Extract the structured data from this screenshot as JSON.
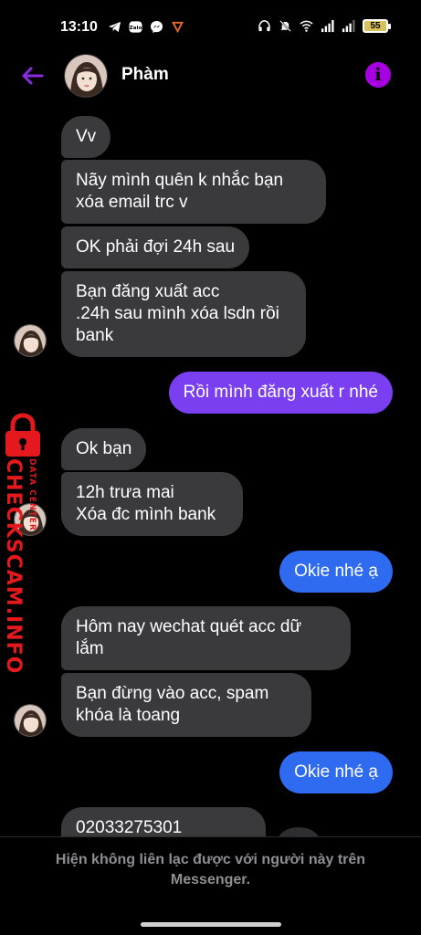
{
  "status_bar": {
    "time": "13:10",
    "left_icons": [
      "telegram-icon",
      "zalo-icon",
      "messenger-icon",
      "vpn-icon"
    ],
    "right_icons": [
      "headphones-icon",
      "mute-icon",
      "wifi-icon",
      "signal-icon",
      "signal-icon"
    ],
    "battery": "55"
  },
  "header": {
    "contact_name": "Phàm",
    "back_icon": "arrow-left-icon",
    "info_icon": "info-icon",
    "info_symbol": "i",
    "accent_color": "#8a2be2"
  },
  "messages": [
    {
      "side": "in",
      "text": "Vv"
    },
    {
      "side": "in",
      "text": "Nãy  mình  quên  k nhắc  bạn\nxóa email  trc v"
    },
    {
      "side": "in",
      "text": "OK  phải  đợi 24h sau"
    },
    {
      "side": "in",
      "text": "Bạn  đăng xuất acc\n.24h sau mình xóa lsdn rồi\nbank"
    },
    {
      "side": "out",
      "text": "Rồi mình đăng xuất r nhé",
      "color": "#7b3ff2"
    },
    {
      "side": "in",
      "text": "Ok  bạn"
    },
    {
      "side": "in",
      "text": "12h trưa mai\nXóa đc  mình bank"
    },
    {
      "side": "out",
      "text": "Okie nhé ạ",
      "color": "#2f6bf0"
    },
    {
      "side": "in",
      "text": "Hôm nay wechat  quét acc dữ\nlắm"
    },
    {
      "side": "in",
      "text": "Bạn  đừng  vào  acc,  spam\nkhóa là  toang"
    },
    {
      "side": "out",
      "text": "Okie nhé ạ",
      "color": "#2f6bf0"
    },
    {
      "side": "in",
      "text": "02033275301"
    }
  ],
  "watermark": {
    "brand": "CHECKSCAM.INFO",
    "sub": "DATA CENTER"
  },
  "footer": {
    "notice": "Hiện không liên lạc được với người này trên Messenger."
  }
}
